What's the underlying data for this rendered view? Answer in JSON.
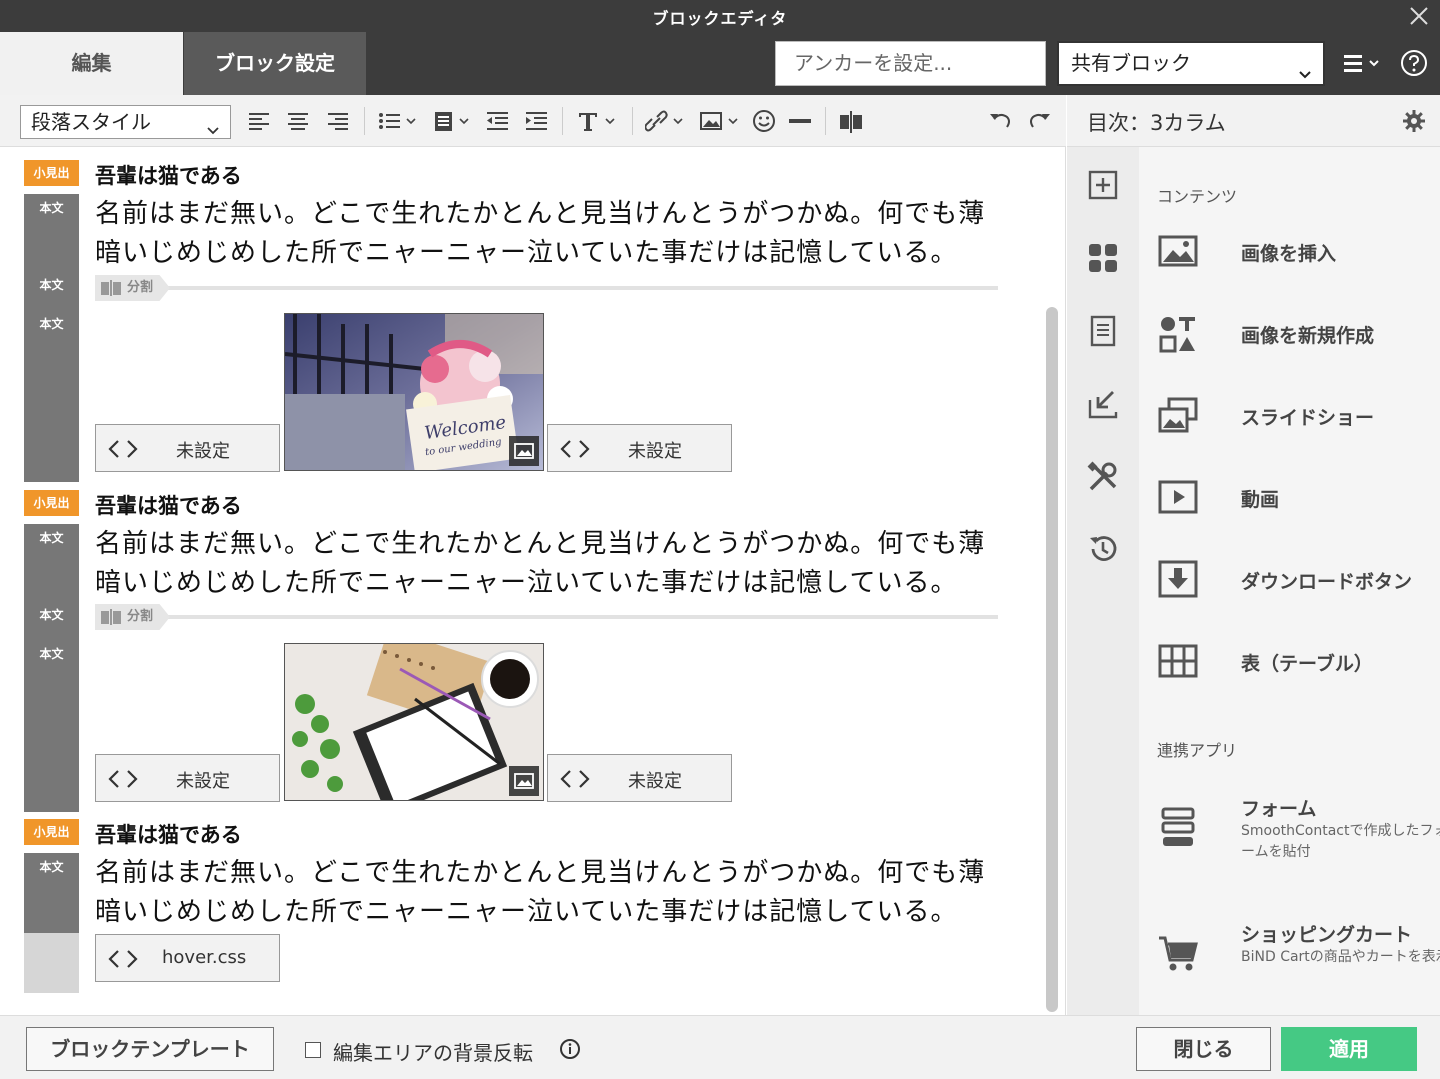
{
  "window": {
    "title": "ブロックエディタ"
  },
  "tabs": [
    {
      "label": "編集"
    },
    {
      "label": "ブロック設定"
    }
  ],
  "anchor": {
    "placeholder": "アンカーを設定..."
  },
  "shared_block": {
    "selected": "共有ブロック"
  },
  "toolbar": {
    "paragraph_style": "段落スタイル"
  },
  "editor": {
    "blocks": [
      {
        "badge_heading": "小見出",
        "badge_body": "本文",
        "heading": "吾輩は猫である",
        "paragraph_line1": "名前はまだ無い。どこで生れたかとんと見当けんとうがつかぬ。何でも薄",
        "paragraph_line2": "暗いじめじめした所でニャーニャー泣いていた事だけは記憶している。",
        "split_label": "分割",
        "badge_body_2": "本文",
        "badge_body_3": "本文",
        "left_code": "未設定",
        "right_code": "未設定"
      },
      {
        "badge_heading": "小見出",
        "badge_body": "本文",
        "heading": "吾輩は猫である",
        "paragraph_line1": "名前はまだ無い。どこで生れたかとんと見当けんとうがつかぬ。何でも薄",
        "paragraph_line2": "暗いじめじめした所でニャーニャー泣いていた事だけは記憶している。",
        "split_label": "分割",
        "badge_body_2": "本文",
        "badge_body_3": "本文",
        "left_code": "未設定",
        "right_code": "未設定"
      },
      {
        "badge_heading": "小見出",
        "badge_body": "本文",
        "heading": "吾輩は猫である",
        "paragraph_line1": "名前はまだ無い。どこで生れたかとんと見当けんとうがつかぬ。何でも薄",
        "paragraph_line2": "暗いじめじめした所でニャーニャー泣いていた事だけは記憶している。",
        "code": "hover.css"
      }
    ]
  },
  "right_panel": {
    "title": "目次：3カラム",
    "sections": [
      {
        "title": "コンテンツ",
        "items": [
          {
            "icon": "image-icon",
            "label": "画像を挿入"
          },
          {
            "icon": "shapes-icon",
            "label": "画像を新規作成"
          },
          {
            "icon": "slideshow-icon",
            "label": "スライドショー"
          },
          {
            "icon": "video-icon",
            "label": "動画"
          },
          {
            "icon": "download-icon",
            "label": "ダウンロードボタン"
          },
          {
            "icon": "table-icon",
            "label": "表（テーブル）"
          }
        ]
      },
      {
        "title": "連携アプリ",
        "items": [
          {
            "icon": "form-icon",
            "label": "フォーム",
            "description": "SmoothContactで作成したフォームを貼付"
          },
          {
            "icon": "cart-icon",
            "label": "ショッピングカート",
            "description": "BiND Cartの商品やカートを表示"
          }
        ]
      }
    ]
  },
  "footer": {
    "template_button": "ブロックテンプレート",
    "invert_background_label": "編集エリアの背景反転",
    "invert_background_checked": false,
    "close_button": "閉じる",
    "apply_button": "適用"
  },
  "colors": {
    "accent_heading_badge": "#f0962a",
    "apply_button": "#45c984",
    "title_bar": "#3c3c3c"
  }
}
